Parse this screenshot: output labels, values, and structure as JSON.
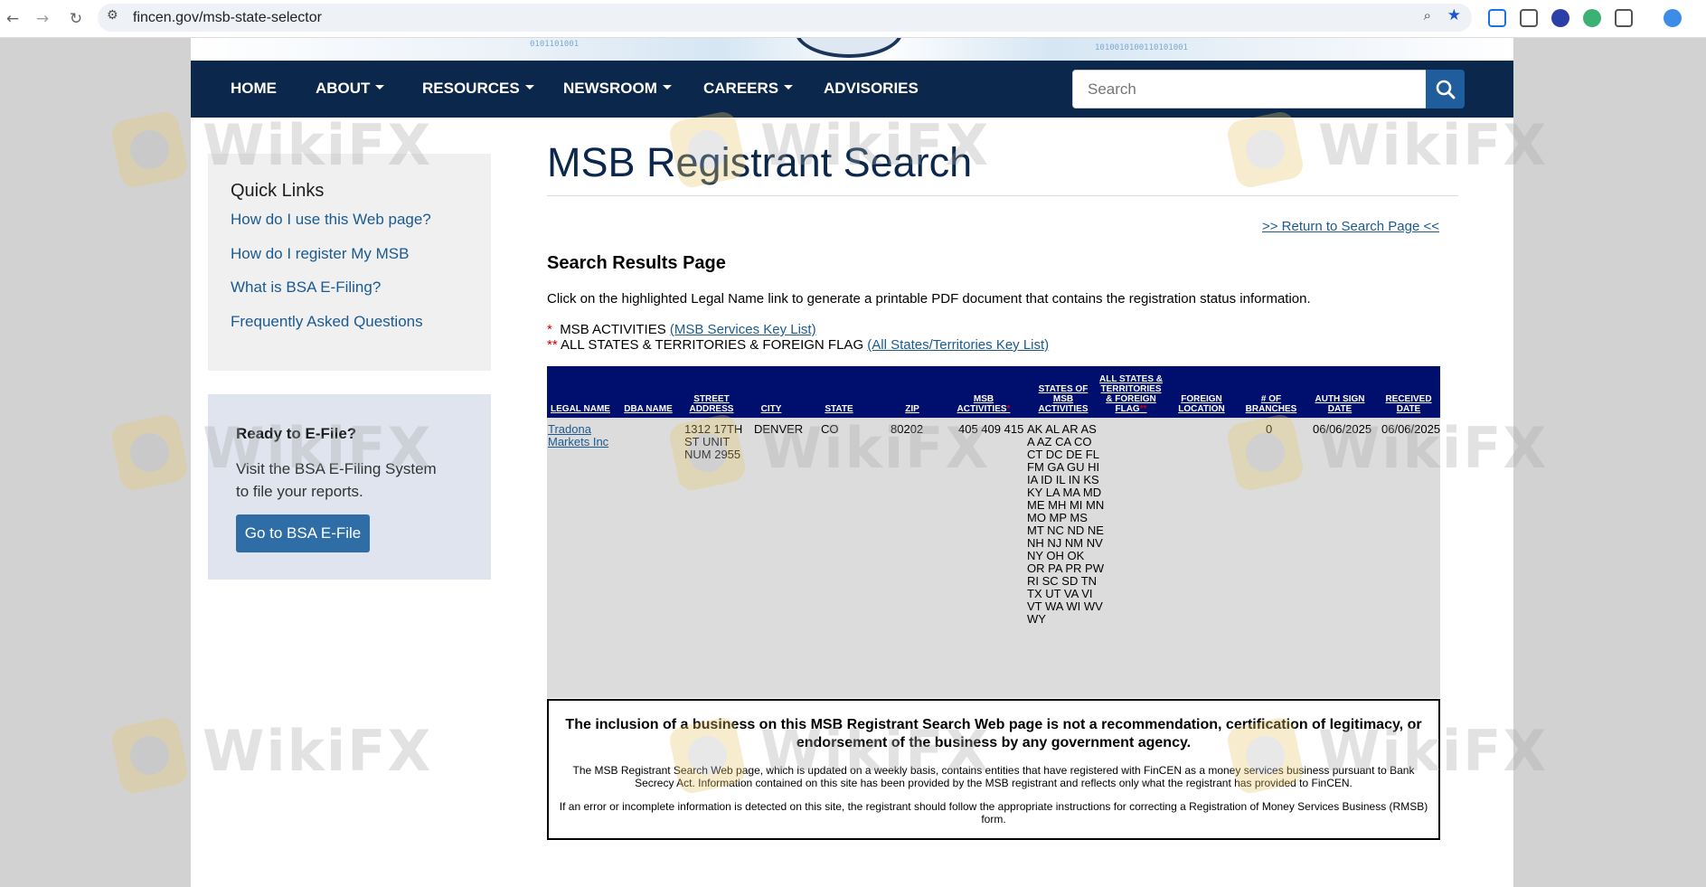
{
  "browser": {
    "url": "fincen.gov/msb-state-selector"
  },
  "nav": {
    "home": "HOME",
    "about": "ABOUT",
    "resources": "RESOURCES",
    "newsroom": "NEWSROOM",
    "careers": "CAREERS",
    "advisories": "ADVISORIES",
    "search_placeholder": "Search"
  },
  "sidebar": {
    "quick_links_title": "Quick Links",
    "links": [
      "How do I use this Web page?",
      "How do I register My MSB",
      "What is BSA E-Filing?",
      "Frequently Asked Questions"
    ],
    "efile_title": "Ready to E-File?",
    "efile_text": "Visit the BSA E-Filing System to file your reports.",
    "efile_button": "Go to BSA E-File"
  },
  "main": {
    "title": "MSB Registrant Search",
    "return_link": ">> Return to Search Page <<",
    "results_heading": "Search Results Page",
    "instruction": "Click on the highlighted Legal Name link to generate a printable PDF document that contains the registration status information.",
    "legend": {
      "star1": "*",
      "activities_label": "MSB ACTIVITIES",
      "activities_link": "(MSB Services Key List)",
      "star2": "**",
      "states_label": "ALL STATES & TERRITORIES & FOREIGN FLAG",
      "states_link": "(All States/Territories Key List)"
    }
  },
  "table": {
    "headers": {
      "legal_name": "LEGAL NAME",
      "dba_name": "DBA NAME",
      "street_address": "STREET ADDRESS",
      "city": "CITY",
      "state": "STATE",
      "zip": "ZIP",
      "msb_activities": "MSB ACTIVITIES",
      "states_of_msb_activities": "STATES OF MSB ACTIVITIES",
      "all_states": "ALL STATES & TERRITORIES & FOREIGN FLAG",
      "foreign_location": "FOREIGN LOCATION",
      "num_branches": "# OF BRANCHES",
      "auth_sign_date": "AUTH SIGN DATE",
      "received_date": "RECEIVED DATE"
    },
    "row": {
      "legal_name": "Tradona Markets Inc",
      "dba_name": "",
      "street_address": "1312 17TH ST UNIT NUM 2955",
      "city": "DENVER",
      "state": "CO",
      "zip": "80202",
      "msb_activities": "405 409 415",
      "states_of_msb_activities": "AK AL AR AS A AZ CA CO CT DC DE FL FM GA GU HI IA ID IL IN KS KY LA MA MD ME MH MI MN MO MP MS MT NC ND NE NH NJ NM NV NY OH OK OR PA PR PW RI SC SD TN TX UT VA VI VT WA WI WV WY",
      "all_states": "",
      "foreign_location": "",
      "num_branches": "0",
      "auth_sign_date": "06/06/2025",
      "received_date": "06/06/2025"
    }
  },
  "disclaimer": {
    "headline": "The inclusion of a business on this MSB Registrant Search Web page is not a recommendation, certification of legitimacy, or endorsement of the business by any government agency.",
    "paragraph1": "The MSB Registrant Search Web page, which is updated on a weekly basis, contains entities that have registered with FinCEN as a money services business pursuant to Bank Secrecy Act. Information contained on this site has been provided by the MSB registrant and reflects only what the registrant has provided to FinCEN.",
    "paragraph2": "If an error or incomplete information is detected on this site, the registrant should follow the appropriate instructions for correcting a Registration of Money Services Business (RMSB) form."
  },
  "watermark": {
    "text": "WikiFX"
  },
  "colors": {
    "nav_bg": "#0b274b",
    "table_header_bg": "#000f6e",
    "link": "#1a5a8f",
    "button": "#2e6da6"
  }
}
